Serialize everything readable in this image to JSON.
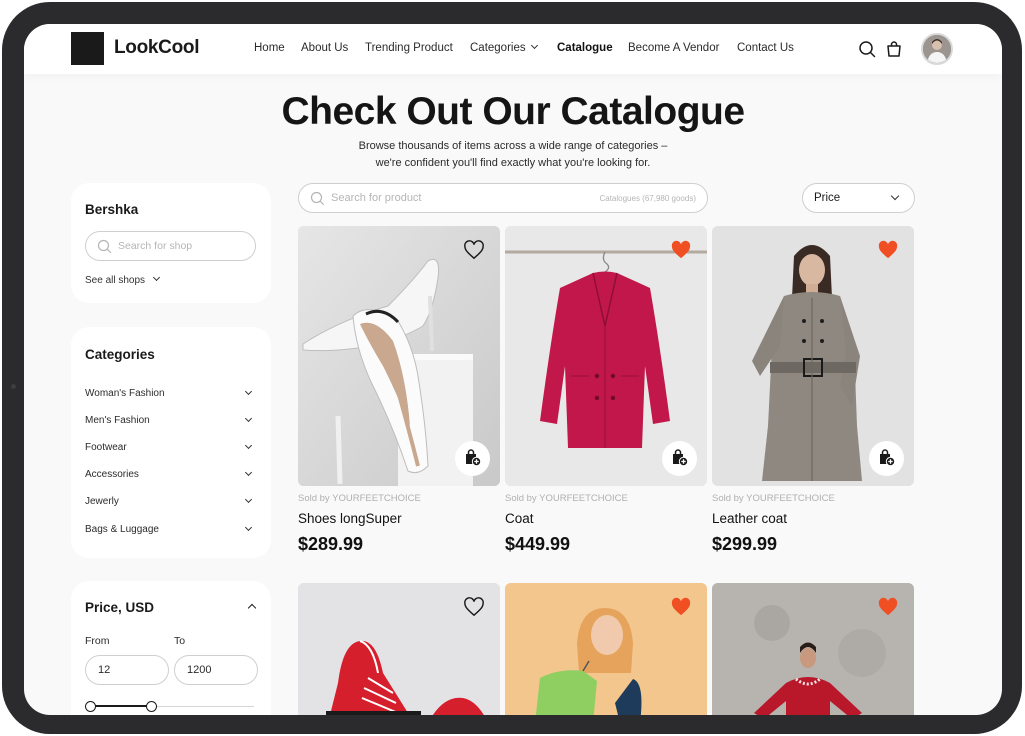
{
  "brand": {
    "name": "LookCool"
  },
  "nav": [
    {
      "label": "Home"
    },
    {
      "label": "About Us"
    },
    {
      "label": "Trending Product"
    },
    {
      "label": "Categories"
    },
    {
      "label": "Catalogue"
    },
    {
      "label": "Become A Vendor"
    },
    {
      "label": "Contact Us"
    }
  ],
  "header_icons": [
    "search-icon",
    "shopping-bag-icon",
    "avatar"
  ],
  "hero": {
    "title": "Check Out Our Catalogue",
    "subtitle_line1": "Browse thousands of items across a wide range of categories –",
    "subtitle_line2": "we're confident you'll find exactly what you're looking for."
  },
  "shop_filter": {
    "title": "Bershka",
    "search_placeholder": "Search for shop",
    "see_all": "See all shops"
  },
  "categories": {
    "title": "Categories",
    "items": [
      {
        "label": "Woman's Fashion"
      },
      {
        "label": "Men's Fashion"
      },
      {
        "label": "Footwear"
      },
      {
        "label": "Accessories"
      },
      {
        "label": "Jewerly"
      },
      {
        "label": "Bags & Luggage"
      }
    ]
  },
  "price_filter": {
    "title": "Price, USD",
    "from_label": "From",
    "to_label": "To",
    "from_value": "12",
    "to_value": "1200"
  },
  "search": {
    "placeholder": "Search for product",
    "count": "Catalogues (67,980 goods)"
  },
  "sort": {
    "label": "Price"
  },
  "products": [
    {
      "seller": "Sold by YOURFEETCHOICE",
      "name": "Shoes longSuper",
      "price": "$289.99",
      "liked": false
    },
    {
      "seller": "Sold by YOURFEETCHOICE",
      "name": "Coat",
      "price": "$449.99",
      "liked": true
    },
    {
      "seller": "Sold by YOURFEETCHOICE",
      "name": "Leather coat",
      "price": "$299.99",
      "liked": true
    },
    {
      "liked": false
    },
    {
      "liked": true
    },
    {
      "liked": true
    }
  ],
  "colors": {
    "accent": "#f04e23",
    "text": "#1a1a1a",
    "bezel": "#2b2b2d"
  }
}
